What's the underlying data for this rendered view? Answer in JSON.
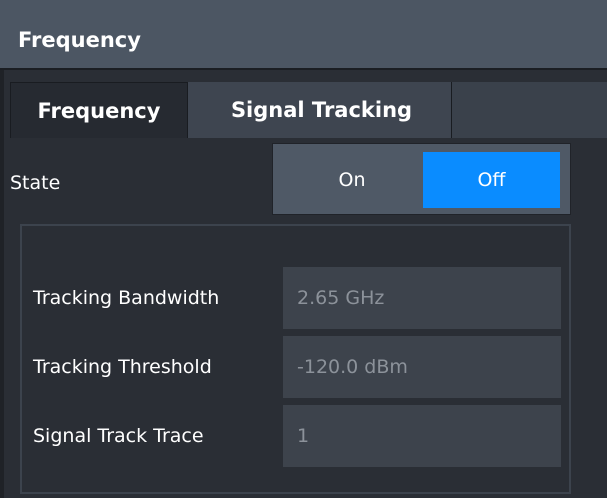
{
  "dialog": {
    "title": "Frequency"
  },
  "tabs": [
    {
      "label": "Frequency",
      "active": false
    },
    {
      "label": "Signal Tracking",
      "active": true
    }
  ],
  "state": {
    "label": "State",
    "options": [
      "On",
      "Off"
    ],
    "selected": "Off",
    "selected_color": "#0a8cff"
  },
  "fields": {
    "tracking_bandwidth": {
      "label": "Tracking Bandwidth",
      "value": "2.65 GHz"
    },
    "tracking_threshold": {
      "label": "Tracking Threshold",
      "value": "-120.0 dBm"
    },
    "signal_track_trace": {
      "label": "Signal Track Trace",
      "value": "1"
    }
  }
}
